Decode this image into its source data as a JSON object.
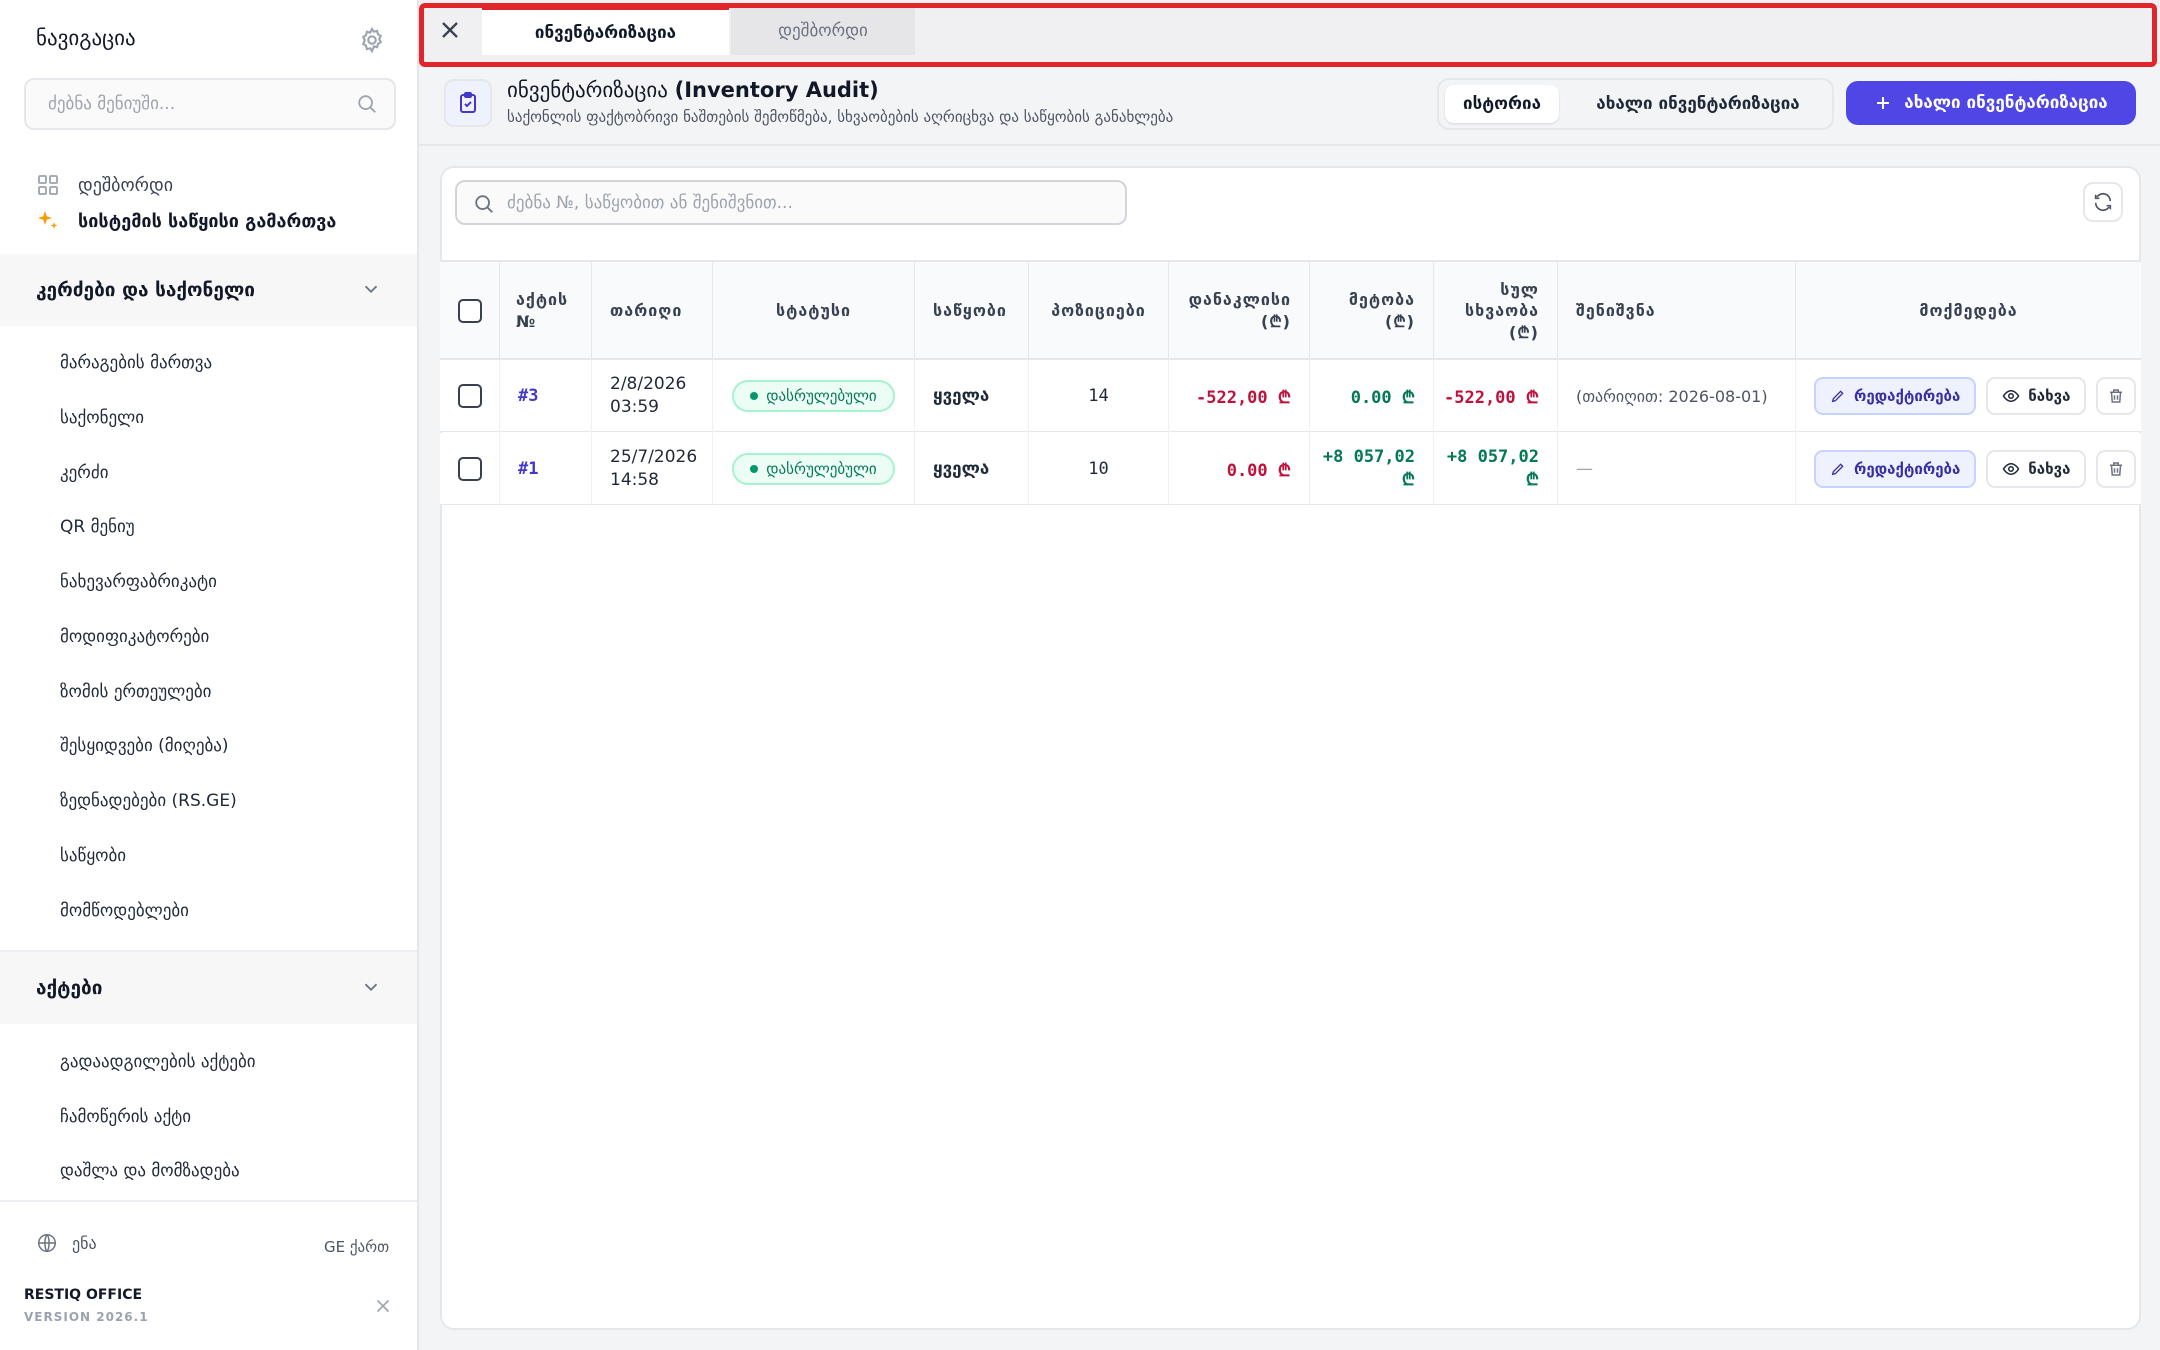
{
  "sidebar": {
    "title": "ნავიგაცია",
    "search_placeholder": "ძებნა მენიუში...",
    "top_items": [
      {
        "label": "დეშბორდი",
        "icon": "grid-icon"
      },
      {
        "label": "სისტემის საწყისი გამართვა",
        "icon": "sparkles-icon"
      }
    ],
    "sections": [
      {
        "label": "კერძები და საქონელი",
        "items": [
          "მარაგების მართვა",
          "საქონელი",
          "კერძი",
          "QR მენიუ",
          "ნახევარფაბრიკატი",
          "მოდიფიკატორები",
          "ზომის ერთეულები",
          "შესყიდვები (მიღება)",
          "ზედნადებები (RS.GE)",
          "საწყობი",
          "მომწოდებლები"
        ]
      },
      {
        "label": "აქტები",
        "items": [
          "გადაადგილების აქტები",
          "ჩამოწერის აქტი",
          "დაშლა და მომზადება"
        ]
      }
    ],
    "footer": {
      "lang_label": "ენა",
      "lang_value": "GE ქართ",
      "brand": "RESTIQ OFFICE",
      "version": "VERSION 2026.1"
    }
  },
  "tabs": [
    {
      "label": "ინვენტარიზაცია",
      "active": true
    },
    {
      "label": "დეშბორდი",
      "active": false
    }
  ],
  "header": {
    "title_ka": "ინვენტარიზაცია ",
    "title_en": "(Inventory Audit)",
    "subtitle": "საქონლის ფაქტობრივი ნაშთების შემოწმება, სხვაობების აღრიცხვა და საწყობის განახლება",
    "seg_history": "ისტორია",
    "seg_new": "ახალი ინვენტარიზაცია",
    "new_button": "ახალი ინვენტარიზაცია"
  },
  "table": {
    "search_placeholder": "ძებნა №, საწყობით ან შენიშვნით...",
    "columns": {
      "act_no_1": "აქტის",
      "act_no_2": "№",
      "date": "თარიღი",
      "status": "სტატუსი",
      "warehouse": "საწყობი",
      "positions": "პოზიციები",
      "shortage_1": "დანაკლისი",
      "shortage_2": "(₾)",
      "surplus_1": "მეტობა",
      "surplus_2": "(₾)",
      "diff_1": "სულ",
      "diff_2": "სხვაობა",
      "diff_3": "(₾)",
      "note": "შენიშვნა",
      "actions": "მოქმედება"
    },
    "rows": [
      {
        "act": "#3",
        "date_1": "2/8/2026",
        "date_2": "03:59",
        "status": "დასრულებული",
        "warehouse": "ყველა",
        "positions": "14",
        "shortage": "-522,00 ₾",
        "surplus": "0.00 ₾",
        "diff_1": "-522,00 ₾",
        "diff_2": "",
        "note": "(თარიღით: 2026-08-01)",
        "edit": "რედაქტირება",
        "view": "ნახვა"
      },
      {
        "act": "#1",
        "date_1": "25/7/2026",
        "date_2": "14:58",
        "status": "დასრულებული",
        "warehouse": "ყველა",
        "positions": "10",
        "shortage": "0.00 ₾",
        "surplus_1": "+8 057,02",
        "surplus_2": "₾",
        "diff_1": "+8 057,02",
        "diff_2": "₾",
        "note": "—",
        "edit": "რედაქტირება",
        "view": "ნახვა"
      }
    ]
  },
  "colors": {
    "accent": "#4f46e5",
    "negative": "#be123c",
    "positive": "#047857",
    "highlight": "#e0252b"
  }
}
